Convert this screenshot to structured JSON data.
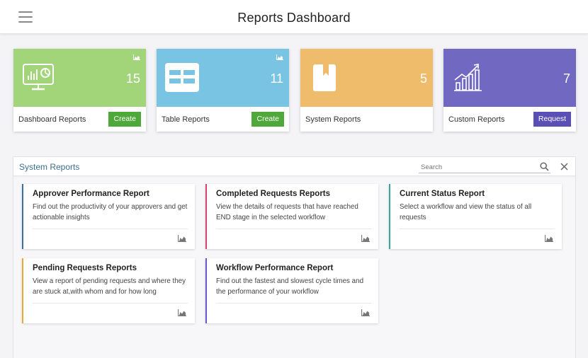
{
  "header": {
    "title": "Reports Dashboard"
  },
  "tiles": [
    {
      "label": "Dashboard Reports",
      "count": "15",
      "button": "Create",
      "color": "#a2d47a",
      "button_color": "#4ea83a",
      "icon": "monitor-chart-icon"
    },
    {
      "label": "Table Reports",
      "count": "11",
      "button": "Create",
      "color": "#79c3e3",
      "button_color": "#4ea83a",
      "icon": "table-icon"
    },
    {
      "label": "System Reports",
      "count": "5",
      "button": "",
      "color": "#efbc6c",
      "button_color": "",
      "icon": "book-icon"
    },
    {
      "label": "Custom Reports",
      "count": "7",
      "button": "Request",
      "color": "#7168c2",
      "button_color": "#5a4fb4",
      "icon": "growth-chart-icon"
    }
  ],
  "panel": {
    "title": "System Reports",
    "search_placeholder": "Search",
    "cards": [
      {
        "title": "Approver Performance Report",
        "desc": "Find out the productivity of your approvers and get actionable insights",
        "accent": "#3a6ea5"
      },
      {
        "title": "Completed Requests Reports",
        "desc": "View the details of requests that have reached END stage in the selected workflow",
        "accent": "#d6456e"
      },
      {
        "title": "Current Status Report",
        "desc": "Select a workflow and view the status of all requests",
        "accent": "#3aa39a"
      },
      {
        "title": "Pending Requests Reports",
        "desc": "View a report of pending requests and where they are stuck at,with whom and for how long",
        "accent": "#f0a830"
      },
      {
        "title": "Workflow Performance Report",
        "desc": "Find out the fastest and slowest cycle times and the performance of your workflow",
        "accent": "#6a5acd"
      }
    ]
  }
}
